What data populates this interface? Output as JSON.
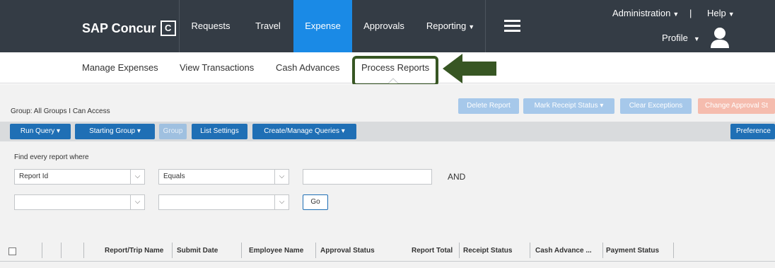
{
  "header": {
    "logo": "SAP Concur",
    "logo_mark": "C",
    "nav": [
      {
        "label": "Requests"
      },
      {
        "label": "Travel"
      },
      {
        "label": "Expense"
      },
      {
        "label": "Approvals"
      },
      {
        "label": "Reporting"
      }
    ],
    "active_nav": "Expense",
    "administration": "Administration",
    "pipe": "|",
    "help": "Help",
    "profile": "Profile",
    "active_color": "#1a8ae6",
    "bar_color": "#343c45"
  },
  "subnav": {
    "items": [
      {
        "label": "Manage Expenses"
      },
      {
        "label": "View Transactions"
      },
      {
        "label": "Cash Advances"
      },
      {
        "label": "Process Reports"
      }
    ],
    "highlight_color": "#375623"
  },
  "page": {
    "group_label": "Group: All Groups I Can Access",
    "actions": [
      {
        "label": "Delete Report"
      },
      {
        "label": "Mark Receipt Status ▾"
      },
      {
        "label": "Clear Exceptions"
      },
      {
        "label": "Change Approval St"
      }
    ],
    "toolbar": [
      {
        "label": "Run Query ▾"
      },
      {
        "label": "Starting Group ▾"
      },
      {
        "label": "Group"
      },
      {
        "label": "List Settings"
      },
      {
        "label": "Create/Manage Queries ▾"
      },
      {
        "label": "Preference"
      }
    ],
    "find_label": "Find every report where",
    "field_select": "Report Id",
    "operator_select": "Equals",
    "value_input": "",
    "and_label": "AND",
    "field_select_2": "",
    "operator_select_2": "",
    "go_label": "Go"
  },
  "table": {
    "columns": [
      "Report/Trip Name",
      "Submit Date",
      "Employee Name",
      "Approval Status",
      "Report Total",
      "Receipt Status",
      "Cash Advance ...",
      "Payment Status"
    ]
  }
}
